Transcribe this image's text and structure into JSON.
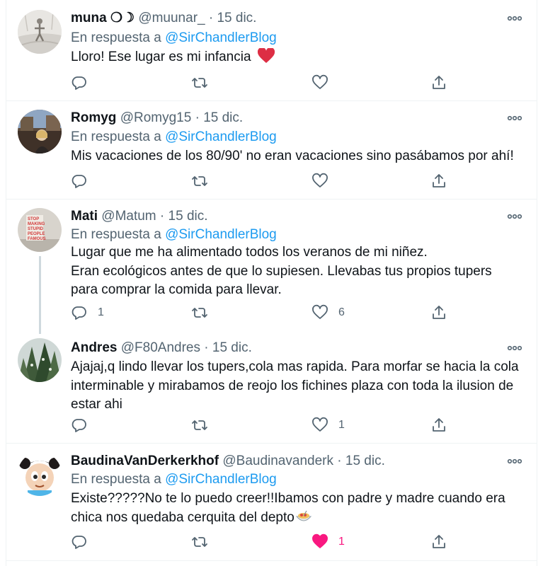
{
  "tweets": [
    {
      "name": "muna ❍☽",
      "handle": "@muunar_",
      "date": "15 dic.",
      "reply_prefix": "En respuesta a",
      "reply_to": "@SirChandlerBlog",
      "text": "Lloro! Ese lugar es mi infancia",
      "text_emoji": "heart",
      "replies": "",
      "likes": "",
      "liked": false
    },
    {
      "name": "Romyg",
      "handle": "@Romyg15",
      "date": "15 dic.",
      "reply_prefix": "En respuesta a",
      "reply_to": "@SirChandlerBlog",
      "text": "Mis vacaciones de los 80/90' no eran vacaciones sino pasábamos por ahí!",
      "replies": "",
      "likes": "",
      "liked": false
    },
    {
      "name": "Mati",
      "handle": "@Matum",
      "date": "15 dic.",
      "reply_prefix": "En respuesta a",
      "reply_to": "@SirChandlerBlog",
      "text_lines": [
        "Lugar que me ha alimentado todos los veranos de mi niñez.",
        "Eran ecológicos antes de que lo supiesen. Llevabas tus propios tupers",
        "para comprar la comida para llevar."
      ],
      "avatar_text": [
        "STOP",
        "MAKING",
        "STUPID",
        "PEOPLE",
        "FAMOUS"
      ],
      "replies": "1",
      "likes": "6",
      "liked": false
    },
    {
      "name": "Andres",
      "handle": "@F80Andres",
      "date": "15 dic.",
      "text_lines": [
        "Ajajaj,q lindo llevar los tupers,cola mas rapida. Para morfar se hacia la cola",
        "interminable y mirabamos de reojo los fichines plaza con toda la ilusion de",
        "estar ahi"
      ],
      "replies": "",
      "likes": "1",
      "liked": false
    },
    {
      "name": "BaudinaVanDerkerkhof",
      "handle": "@Baudinavanderk",
      "date": "15 dic.",
      "reply_prefix": "En respuesta a",
      "reply_to": "@SirChandlerBlog",
      "text_lines": [
        "Existe?????No te lo puedo creer!!Ibamos con padre y madre cuando era",
        "chica nos quedaba cerquita del depto"
      ],
      "text_emoji": "spaghetti",
      "replies": "",
      "likes": "1",
      "liked": true
    }
  ],
  "separator": "·",
  "icons": [
    "reply-icon",
    "retweet-icon",
    "like-icon",
    "share-icon",
    "more-icon"
  ],
  "colors": {
    "text": "#0f1419",
    "secondary": "#536471",
    "link": "#1d9bf0",
    "like_active": "#f91880",
    "border": "#eff3f4",
    "thread_line": "#cfd9de"
  }
}
